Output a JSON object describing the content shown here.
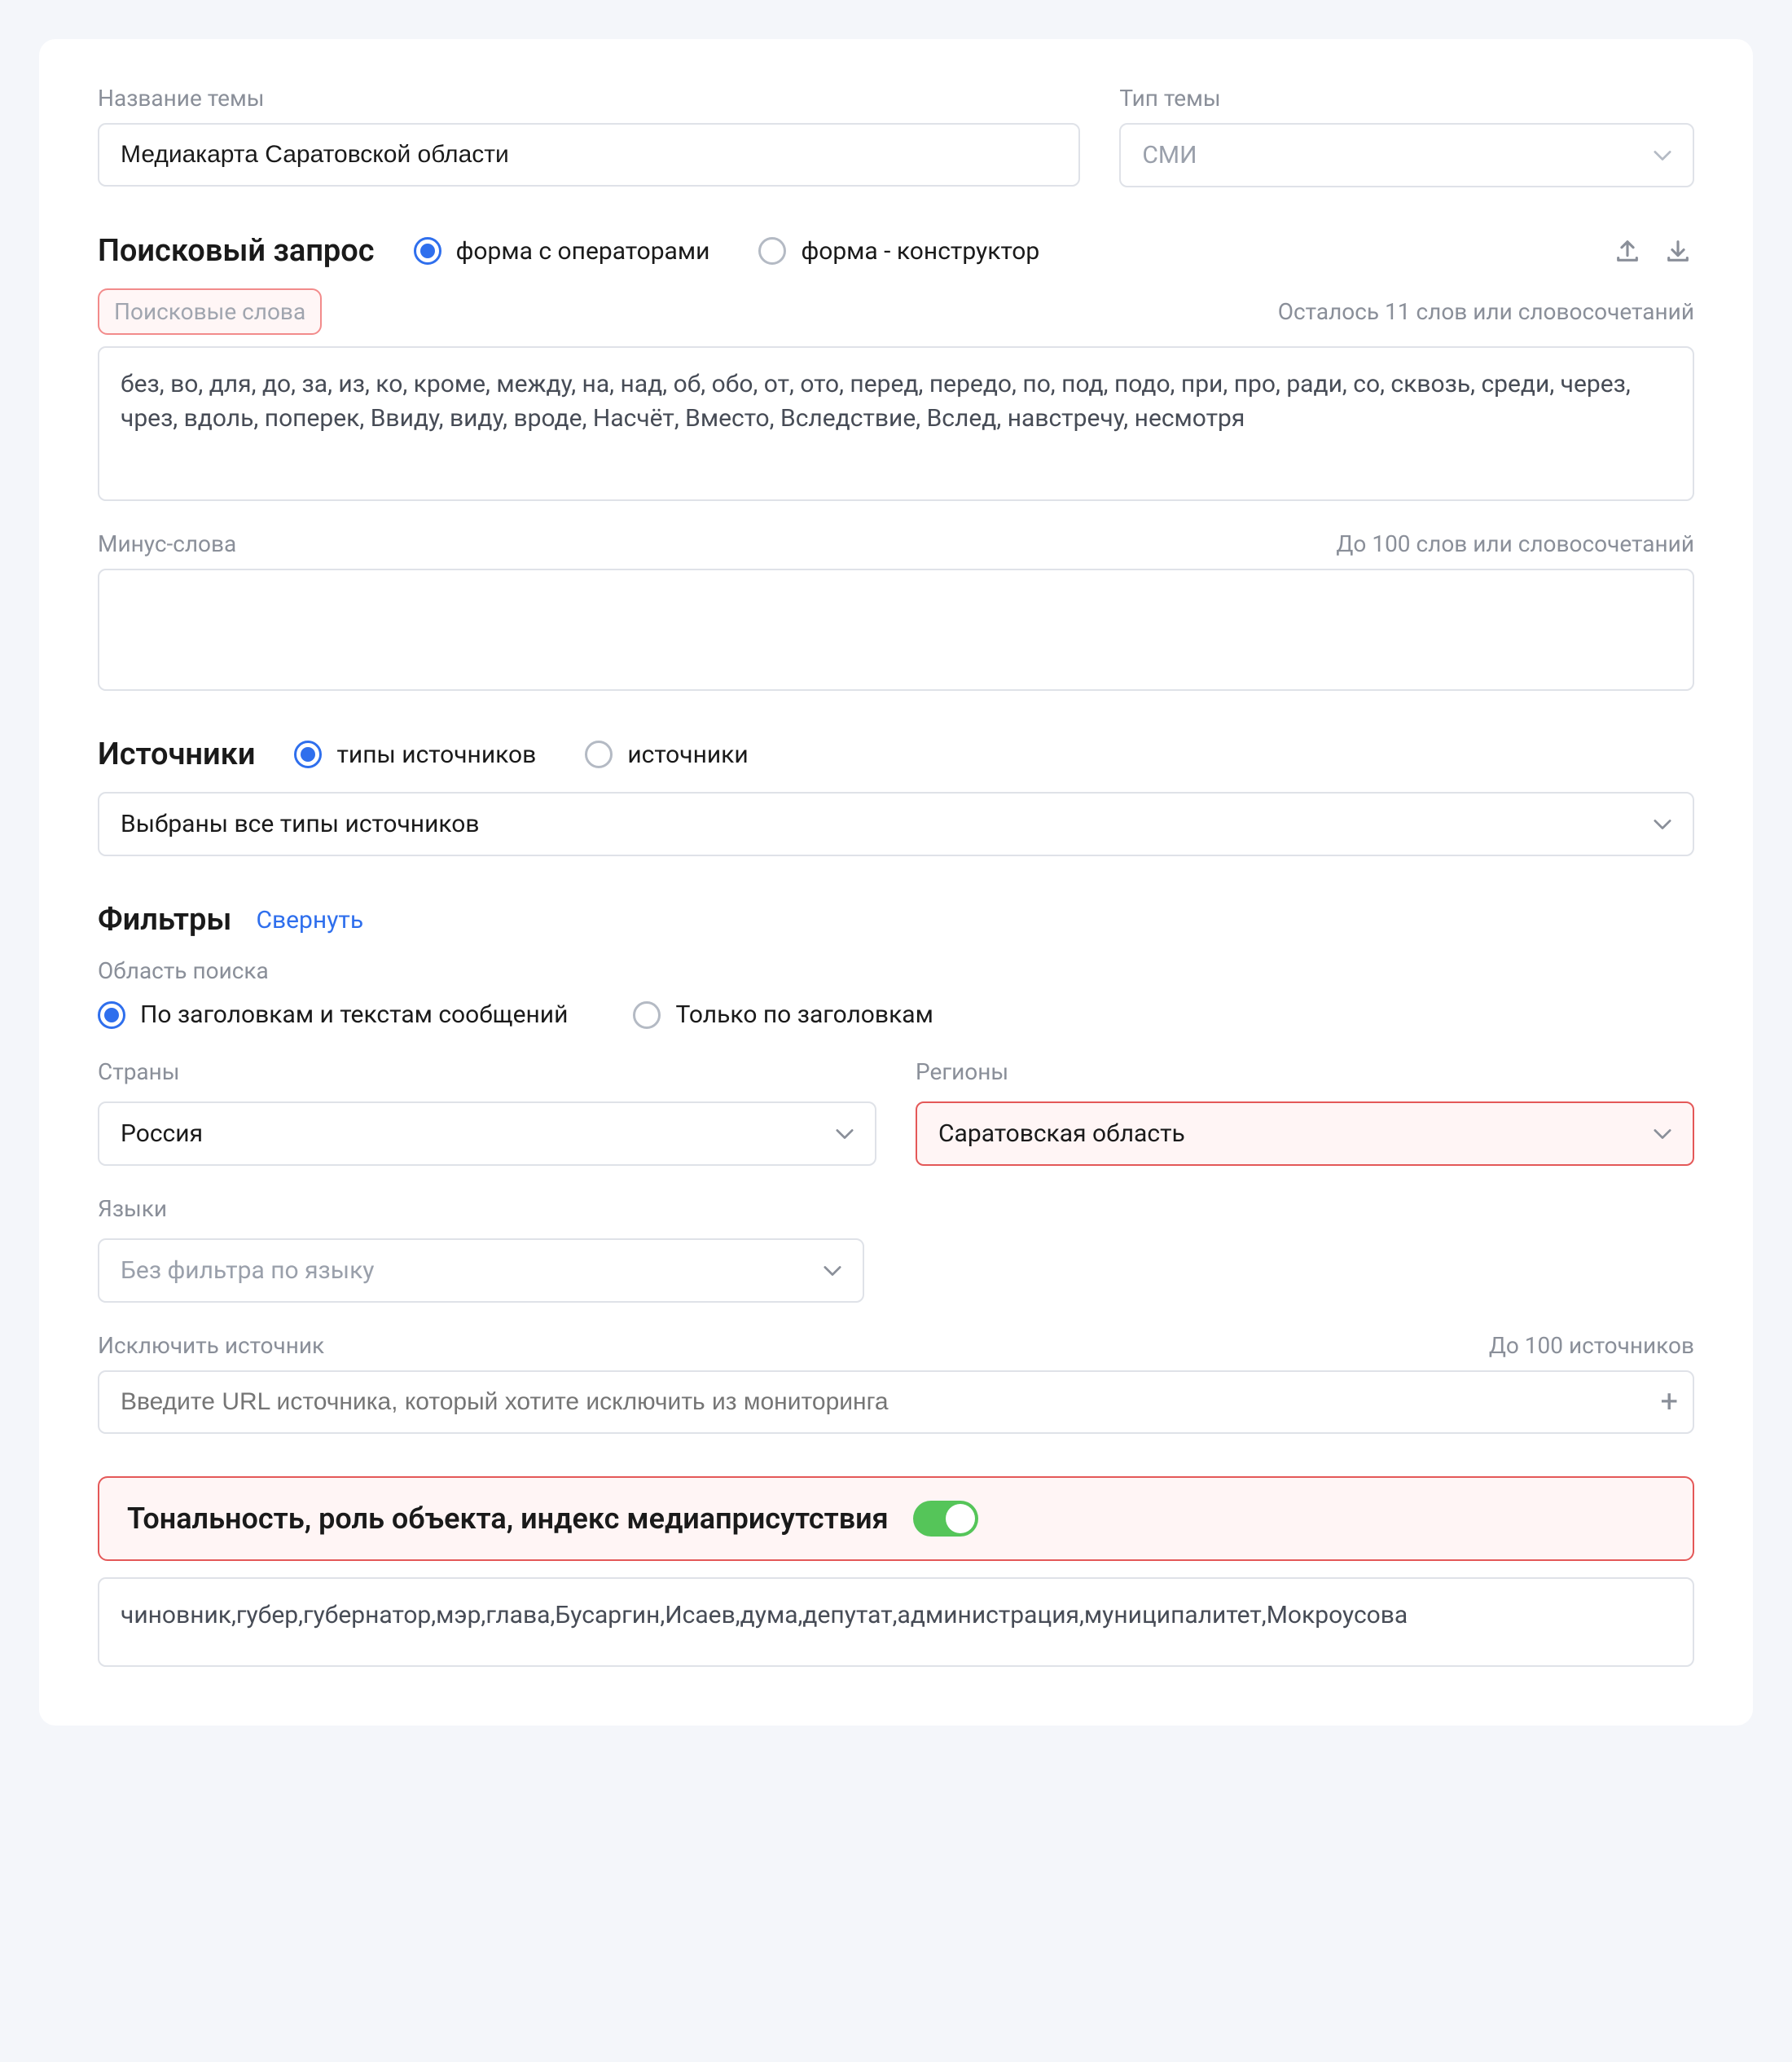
{
  "topic_name": {
    "label": "Название темы",
    "value": "Медиакарта Саратовской области"
  },
  "topic_type": {
    "label": "Тип темы",
    "value": "СМИ"
  },
  "search_query": {
    "title": "Поисковый запрос",
    "radio_operators": "форма с операторами",
    "radio_constructor": "форма - конструктор",
    "keywords_label": "Поисковые слова",
    "keywords_hint": "Осталось 11 слов или словосочетаний",
    "keywords_value": "без, во, для, до, за, из, ко, кроме, между, на, над, об, обо, от, ото, перед, передо, по, под, подо, при, про, ради, со, сквозь, среди, через, чрез, вдоль, поперек, Ввиду, виду, вроде, Насчёт, Вместо, Вследствие, Вслед, навстречу, несмотря",
    "minus_label": "Минус-слова",
    "minus_hint": "До 100 слов или словосочетаний"
  },
  "sources": {
    "title": "Источники",
    "radio_source_types": "типы источников",
    "radio_sources": "источники",
    "select_value": "Выбраны все типы источников"
  },
  "filters": {
    "title": "Фильтры",
    "collapse": "Свернуть",
    "search_area_label": "Область поиска",
    "radio_headlines_texts": "По заголовкам и текстам сообщений",
    "radio_headlines_only": "Только по заголовкам",
    "countries_label": "Страны",
    "countries_value": "Россия",
    "regions_label": "Регионы",
    "regions_value": "Саратовская область",
    "languages_label": "Языки",
    "languages_value": "Без фильтра по языку",
    "exclude_label": "Исключить источник",
    "exclude_hint": "До 100 источников",
    "exclude_placeholder": "Введите URL источника, который хотите исключить из мониторинга"
  },
  "tone_panel": {
    "title": "Тональность, роль объекта, индекс медиаприсутствия",
    "objects_value": "чиновник,губер,губернатор,мэр,глава,Бусаргин,Исаев,дума,депутат,администрация,муниципалитет,Мокроусова"
  }
}
